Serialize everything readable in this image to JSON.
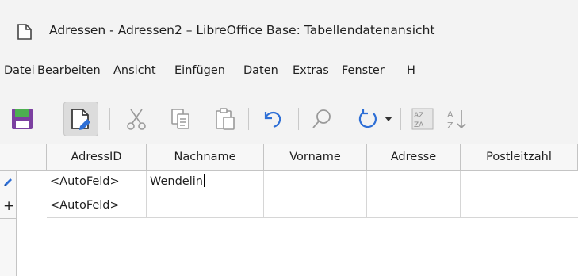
{
  "window": {
    "title": "Adressen - Adressen2 – LibreOffice Base: Tabellendatenansicht",
    "icon": "document-icon"
  },
  "menubar": {
    "items": [
      "Datei",
      "Bearbeiten",
      "Ansicht",
      "Einfügen",
      "Daten",
      "Extras",
      "Fenster",
      "H"
    ]
  },
  "toolbar": {
    "buttons": [
      "save-icon",
      "edit-data-icon",
      "cut-icon",
      "copy-icon",
      "paste-icon",
      "undo-icon",
      "find-icon",
      "refresh-icon",
      "dropdown-arrow-icon",
      "sort-icon",
      "sort-ascending-icon"
    ]
  },
  "table": {
    "columns": [
      "AdressID",
      "Nachname",
      "Vorname",
      "Adresse",
      "Postleitzahl"
    ],
    "rows": [
      {
        "indicator": "pencil-icon",
        "cells": [
          "<AutoFeld>",
          "Wendelin",
          "",
          "",
          ""
        ]
      },
      {
        "indicator": "+",
        "cells": [
          "<AutoFeld>",
          "",
          "",
          "",
          ""
        ]
      }
    ]
  },
  "colors": {
    "accent": "#2e6fd6",
    "save_green": "#4caf50",
    "save_purple": "#7b3fa0"
  }
}
